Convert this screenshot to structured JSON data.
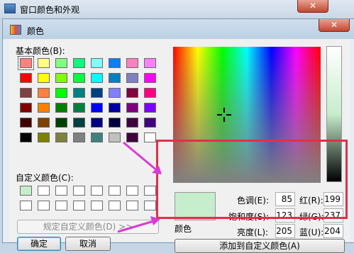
{
  "outer_window": {
    "title": "窗口颜色和外观"
  },
  "dialog": {
    "title": "颜色",
    "basic_colors_label": "基本颜色(B):",
    "custom_colors_label": "自定义颜色(C):",
    "define_custom_button": "规定自定义颜色(D) >>",
    "ok_button": "确定",
    "cancel_button": "取消",
    "preview_label": "颜色",
    "hue_label": "色调(E):",
    "sat_label": "饱和度(S):",
    "lum_label": "亮度(L):",
    "red_label": "红(R):",
    "green_label": "绿(G):",
    "blue_label": "蓝(U):",
    "hue": "85",
    "sat": "123",
    "lum": "205",
    "red": "199",
    "green": "237",
    "blue": "204",
    "add_custom_button": "添加到自定义颜色(A)",
    "current_color": "#c6edcc"
  },
  "basic_colors": [
    "#ff8080",
    "#ffff80",
    "#80ff80",
    "#00ff80",
    "#80ffff",
    "#0080ff",
    "#ff80c0",
    "#ff80ff",
    "#ff0000",
    "#ffff00",
    "#80ff00",
    "#00ff40",
    "#00ffff",
    "#0080c0",
    "#8080c0",
    "#ff00ff",
    "#804040",
    "#ff8040",
    "#00ff00",
    "#008080",
    "#004080",
    "#8080ff",
    "#800040",
    "#ff0080",
    "#800000",
    "#ff8000",
    "#008000",
    "#008040",
    "#0000ff",
    "#0000a0",
    "#800080",
    "#8000ff",
    "#400000",
    "#804000",
    "#004000",
    "#004040",
    "#000080",
    "#000040",
    "#400040",
    "#400080",
    "#000000",
    "#808000",
    "#808040",
    "#808080",
    "#408080",
    "#c0c0c0",
    "#400040",
    "#ffffff"
  ],
  "custom_colors": [
    "#c6edcc",
    "#ffffff",
    "#ffffff",
    "#ffffff",
    "#ffffff",
    "#ffffff",
    "#ffffff",
    "#ffffff",
    "#ffffff",
    "#ffffff",
    "#ffffff",
    "#ffffff",
    "#ffffff",
    "#ffffff",
    "#ffffff",
    "#ffffff"
  ],
  "accent": {
    "highlight_box": "#e0304a",
    "arrow": "#d93ad8"
  }
}
